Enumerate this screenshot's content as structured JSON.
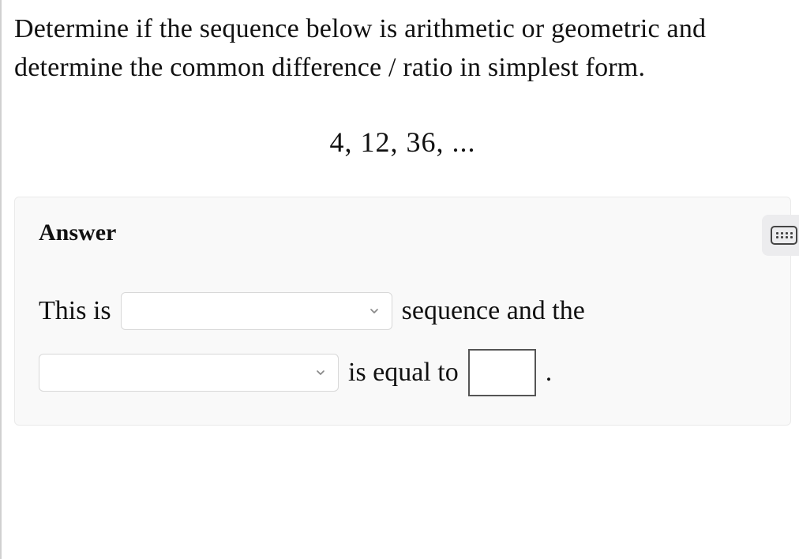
{
  "question": {
    "prompt": "Determine if the sequence below is arithmetic or geometric and determine the common difference / ratio in simplest form.",
    "sequence": "4,  12,  36,  ..."
  },
  "answer": {
    "heading": "Answer",
    "sentence": {
      "part1": "This is",
      "part2": "sequence and the",
      "part3": "is equal to",
      "period": "."
    },
    "dropdown1": {
      "selected": ""
    },
    "dropdown2": {
      "selected": ""
    },
    "value_input": ""
  }
}
